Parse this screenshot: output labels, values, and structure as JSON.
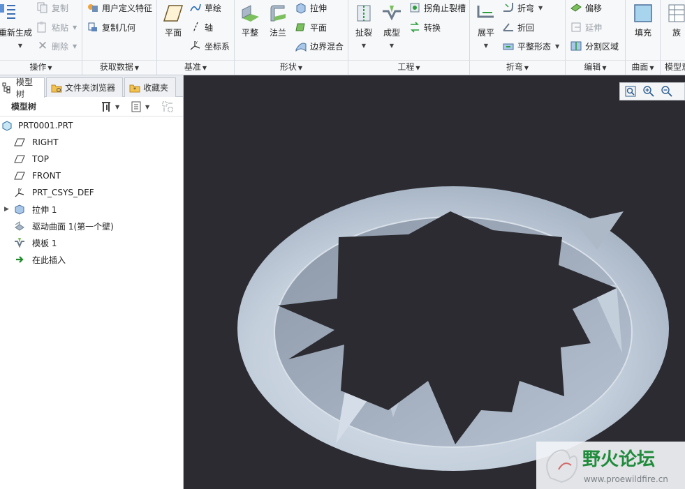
{
  "ribbon": {
    "groups": {
      "operations": {
        "label": "操作",
        "regenerate": "重新生成",
        "copy": "复制",
        "paste": "粘贴",
        "delete": "删除"
      },
      "get_data": {
        "label": "获取数据",
        "user_defined_feature": "用户定义特征",
        "copy_geometry": "复制几何"
      },
      "datum": {
        "label": "基准",
        "plane": "平面",
        "sketch": "草绘",
        "axis": "轴",
        "csys": "坐标系"
      },
      "shapes": {
        "label": "形状",
        "flat": "平整",
        "flange": "法兰",
        "extrude": "拉伸",
        "planar": "平面",
        "boundary_blend": "边界混合"
      },
      "engineering": {
        "label": "工程",
        "rip": "扯裂",
        "form": "成型",
        "corner_relief": "拐角止裂槽",
        "convert": "转换"
      },
      "bends": {
        "label": "折弯",
        "unbend": "展平",
        "bend": "折弯",
        "bend_back": "折回",
        "flatten_form": "平整形态"
      },
      "editing": {
        "label": "编辑",
        "offset": "偏移",
        "extend": "延伸",
        "split_area": "分割区域"
      },
      "surfaces": {
        "label": "曲面",
        "fill": "填充"
      },
      "model_intent": {
        "label": "模型意",
        "family": "族"
      }
    }
  },
  "left_panel": {
    "tabs": [
      "模型树",
      "文件夹浏览器",
      "收藏夹"
    ],
    "header_title": "模型树",
    "tree": [
      {
        "label": "PRT0001.PRT",
        "icon": "part-icon",
        "expandable": false
      },
      {
        "label": "RIGHT",
        "icon": "datum-plane-icon",
        "expandable": false
      },
      {
        "label": "TOP",
        "icon": "datum-plane-icon",
        "expandable": false
      },
      {
        "label": "FRONT",
        "icon": "datum-plane-icon",
        "expandable": false
      },
      {
        "label": "PRT_CSYS_DEF",
        "icon": "csys-icon",
        "expandable": false
      },
      {
        "label": "拉伸 1",
        "icon": "extrude-icon",
        "expandable": true
      },
      {
        "label": "驱动曲面 1(第一个壁)",
        "icon": "driving-surface-icon",
        "expandable": false
      },
      {
        "label": "模板 1",
        "icon": "form-icon",
        "expandable": false
      },
      {
        "label": "在此插入",
        "icon": "insert-here-arrow-icon",
        "expandable": false
      }
    ]
  },
  "viewport": {
    "background": "#2b2b31",
    "part_color": "#c5d0dd",
    "view_tools": [
      "refit-icon",
      "zoom-in-icon",
      "zoom-out-icon"
    ]
  },
  "watermark": {
    "title": "野火论坛",
    "url": "www.proewildfire.cn"
  }
}
